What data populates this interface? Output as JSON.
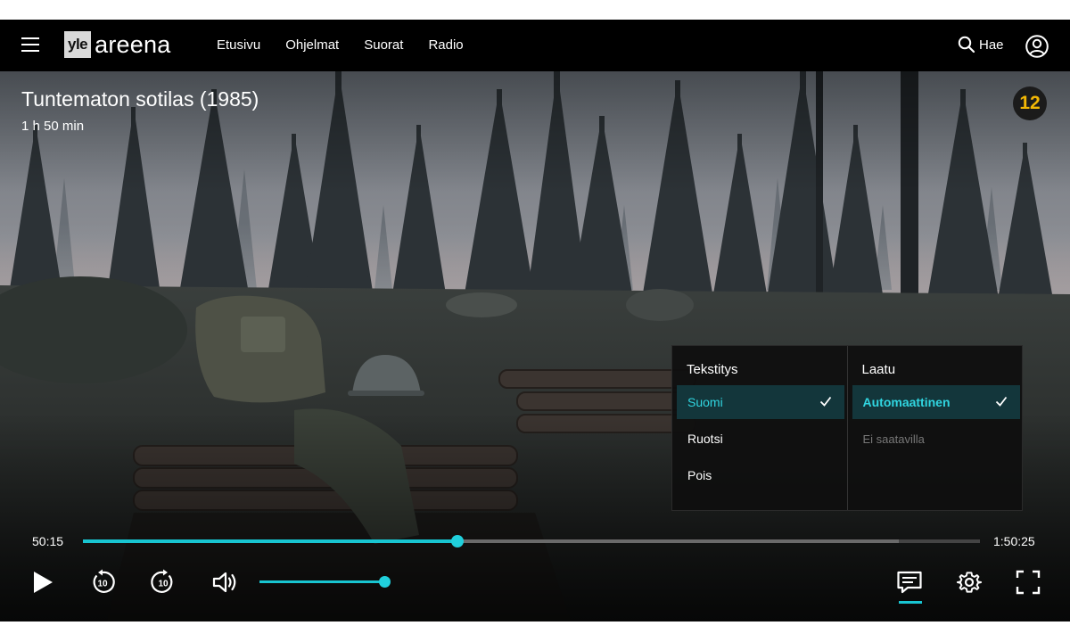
{
  "header": {
    "logo_yle": "yle",
    "logo_areena": "areena",
    "nav": [
      "Etusivu",
      "Ohjelmat",
      "Suorat",
      "Radio"
    ],
    "search_label": "Hae"
  },
  "video": {
    "title": "Tuntematon sotilas (1985)",
    "duration": "1 h 50 min",
    "age_rating": "12"
  },
  "settings": {
    "subtitles": {
      "heading": "Tekstitys",
      "options": [
        {
          "label": "Suomi",
          "selected": true
        },
        {
          "label": "Ruotsi",
          "selected": false
        },
        {
          "label": "Pois",
          "selected": false
        }
      ]
    },
    "quality": {
      "heading": "Laatu",
      "options": [
        {
          "label": "Automaattinen",
          "selected": true
        },
        {
          "label": "Ei saatavilla",
          "disabled": true
        }
      ]
    }
  },
  "player": {
    "current_time": "50:15",
    "total_time": "1:50:25",
    "progress_fraction": 0.417,
    "buffered_fraction": 0.91,
    "volume_fraction": 1.0
  },
  "colors": {
    "accent": "#18c5d1",
    "rating": "#f2b705",
    "selected_bg": "#13363b"
  },
  "icons": {
    "menu": "hamburger-icon",
    "search": "search-icon",
    "account": "user-icon",
    "play": "play-icon",
    "rewind": "rewind-10-icon",
    "forward": "forward-10-icon",
    "volume": "volume-icon",
    "subtitles": "subtitles-icon",
    "settings": "gear-icon",
    "fullscreen": "fullscreen-icon"
  }
}
